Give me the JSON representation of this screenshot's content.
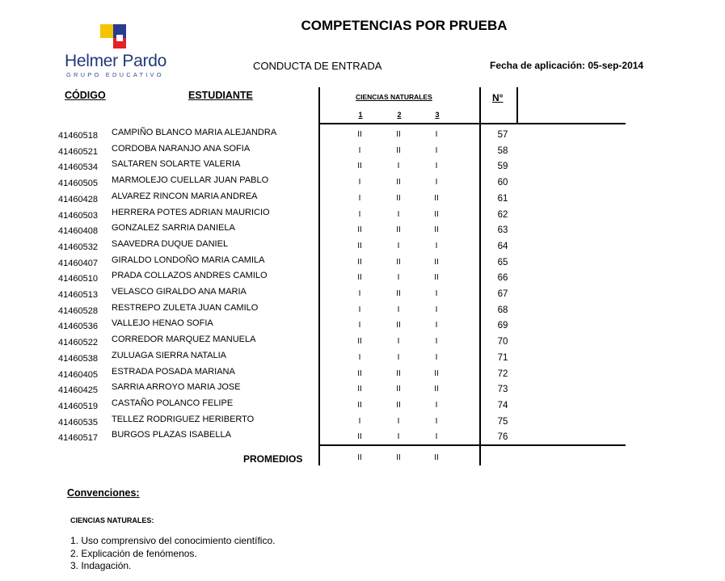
{
  "title": "COMPETENCIAS POR PRUEBA",
  "brand": {
    "name": "Helmer Pardo",
    "subtitle": "GRUPO EDUCATIVO"
  },
  "subtitle": "CONDUCTA DE ENTRADA",
  "date": "Fecha de aplicación: 05-sep-2014",
  "headers": {
    "code": "CÓDIGO",
    "student": "ESTUDIANTE",
    "area": "CIENCIAS NATURALES",
    "sub": [
      "1",
      "2",
      "3"
    ],
    "number": "N°"
  },
  "rows": [
    {
      "code": "41460518",
      "name": "CAMPIÑO BLANCO MARIA ALEJANDRA",
      "v": [
        "II",
        "II",
        "I"
      ],
      "n": "57"
    },
    {
      "code": "41460521",
      "name": "CORDOBA NARANJO ANA SOFIA",
      "v": [
        "I",
        "II",
        "I"
      ],
      "n": "58"
    },
    {
      "code": "41460534",
      "name": "SALTAREN SOLARTE VALERIA",
      "v": [
        "II",
        "I",
        "I"
      ],
      "n": "59"
    },
    {
      "code": "41460505",
      "name": "MARMOLEJO CUELLAR JUAN PABLO",
      "v": [
        "I",
        "II",
        "I"
      ],
      "n": "60"
    },
    {
      "code": "41460428",
      "name": "ALVAREZ RINCON MARIA ANDREA",
      "v": [
        "I",
        "II",
        "II"
      ],
      "n": "61"
    },
    {
      "code": "41460503",
      "name": "HERRERA POTES ADRIAN MAURICIO",
      "v": [
        "I",
        "I",
        "II"
      ],
      "n": "62"
    },
    {
      "code": "41460408",
      "name": "GONZALEZ SARRIA DANIELA",
      "v": [
        "II",
        "II",
        "II"
      ],
      "n": "63"
    },
    {
      "code": "41460532",
      "name": "SAAVEDRA DUQUE DANIEL",
      "v": [
        "II",
        "I",
        "I"
      ],
      "n": "64"
    },
    {
      "code": "41460407",
      "name": "GIRALDO LONDOÑO MARIA CAMILA",
      "v": [
        "II",
        "II",
        "II"
      ],
      "n": "65"
    },
    {
      "code": "41460510",
      "name": "PRADA COLLAZOS ANDRES CAMILO",
      "v": [
        "II",
        "I",
        "II"
      ],
      "n": "66"
    },
    {
      "code": "41460513",
      "name": "VELASCO GIRALDO ANA MARIA",
      "v": [
        "I",
        "II",
        "I"
      ],
      "n": "67"
    },
    {
      "code": "41460528",
      "name": "RESTREPO ZULETA JUAN CAMILO",
      "v": [
        "I",
        "I",
        "I"
      ],
      "n": "68"
    },
    {
      "code": "41460536",
      "name": "VALLEJO HENAO SOFIA",
      "v": [
        "I",
        "II",
        "I"
      ],
      "n": "69"
    },
    {
      "code": "41460522",
      "name": "CORREDOR MARQUEZ MANUELA",
      "v": [
        "II",
        "I",
        "I"
      ],
      "n": "70"
    },
    {
      "code": "41460538",
      "name": "ZULUAGA SIERRA NATALIA",
      "v": [
        "I",
        "I",
        "I"
      ],
      "n": "71"
    },
    {
      "code": "41460405",
      "name": "ESTRADA POSADA MARIANA",
      "v": [
        "II",
        "II",
        "II"
      ],
      "n": "72"
    },
    {
      "code": "41460425",
      "name": "SARRIA ARROYO MARIA JOSE",
      "v": [
        "II",
        "II",
        "II"
      ],
      "n": "73"
    },
    {
      "code": "41460519",
      "name": "CASTAÑO POLANCO FELIPE",
      "v": [
        "II",
        "II",
        "I"
      ],
      "n": "74"
    },
    {
      "code": "41460535",
      "name": "TELLEZ RODRIGUEZ HERIBERTO",
      "v": [
        "I",
        "I",
        "I"
      ],
      "n": "75"
    },
    {
      "code": "41460517",
      "name": "BURGOS PLAZAS ISABELLA",
      "v": [
        "II",
        "I",
        "I"
      ],
      "n": "76"
    }
  ],
  "averages": {
    "label": "PROMEDIOS",
    "values": [
      "II",
      "II",
      "II"
    ]
  },
  "conventions": {
    "title": "Convenciones:",
    "area": "CIENCIAS NATURALES:",
    "items": [
      "1. Uso comprensivo del conocimiento científico.",
      "2. Explicación de fenómenos.",
      "3. Indagación."
    ]
  },
  "colors": {
    "logo_blue": "#1f3a7a",
    "logo_yellow": "#f5c400",
    "logo_red": "#e4212a",
    "logo_navy": "#2b3a93"
  }
}
